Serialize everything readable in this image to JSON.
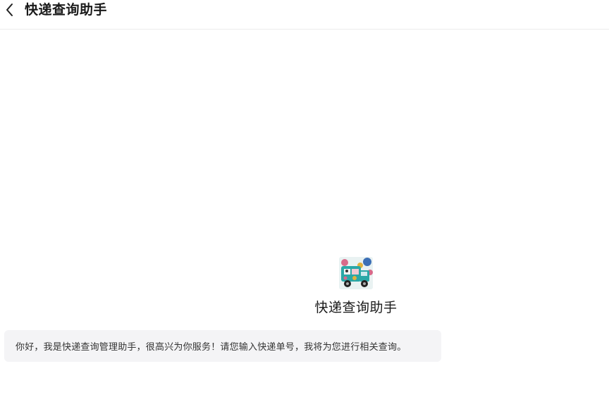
{
  "header": {
    "back_icon": "chevron-left-icon",
    "title": "快递查询助手"
  },
  "bot": {
    "avatar_icon": "delivery-truck-avatar",
    "name": "快递查询助手"
  },
  "messages": [
    {
      "text": "你好，我是快递查询管理助手，很高兴为你服务！请您输入快递单号，我将为您进行相关查询。"
    }
  ],
  "colors": {
    "header_border": "#ececec",
    "bubble_bg": "#f4f4f6",
    "avatar_bg": "#2aa7a7"
  }
}
